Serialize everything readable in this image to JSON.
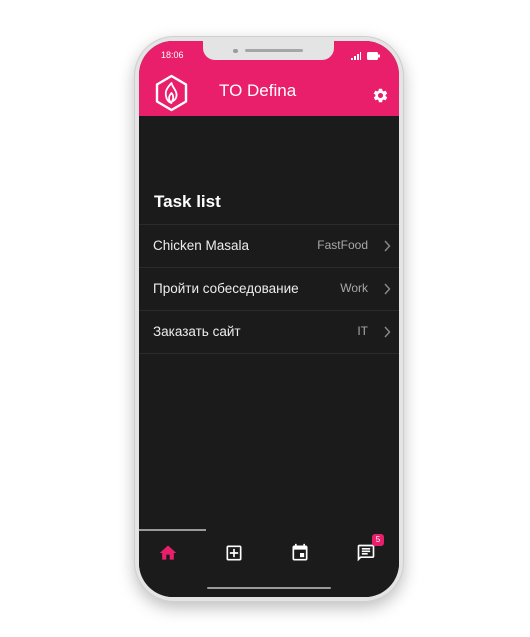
{
  "status_bar": {
    "time": "18:06"
  },
  "header": {
    "title": "TO Defina",
    "background_color": "#ea1f6b",
    "logo_icon": "flame-hexagon-logo",
    "settings_icon": "gear-icon"
  },
  "section": {
    "title": "Task list"
  },
  "tasks": [
    {
      "name": "Chicken Masala",
      "category": "FastFood"
    },
    {
      "name": "Пройти собеседование",
      "category": "Work"
    },
    {
      "name": "Заказать сайт",
      "category": "IT"
    }
  ],
  "tabbar": {
    "items": [
      {
        "icon": "home-icon",
        "active": true
      },
      {
        "icon": "add-box-icon",
        "active": false
      },
      {
        "icon": "calendar-icon",
        "active": false
      },
      {
        "icon": "notes-icon",
        "active": false
      }
    ],
    "badge": "5",
    "active_color": "#ea1f6b",
    "inactive_color": "#ffffff"
  }
}
